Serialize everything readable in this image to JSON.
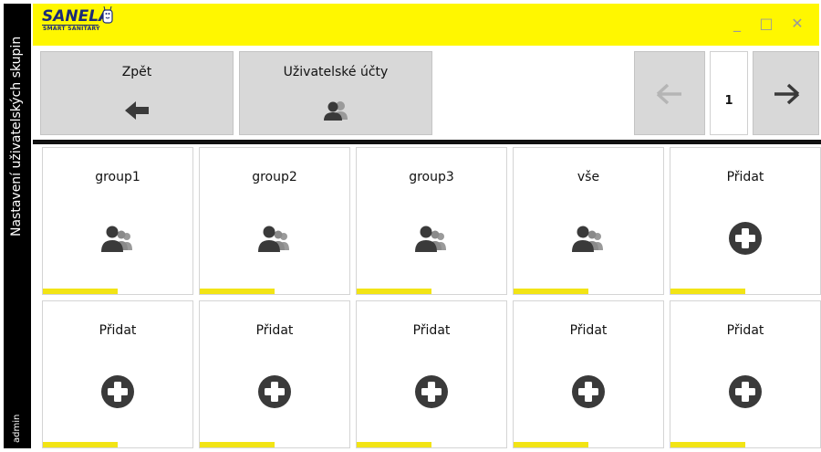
{
  "sidebar": {
    "title": "Nastavení uživatelských skupin",
    "user": "admin"
  },
  "titlebar": {
    "logo_text": "SANELA",
    "logo_subtitle": "SMART SANITARY",
    "brand_color": "#fff700",
    "window_controls": {
      "minimize": "_",
      "maximize": "□",
      "close": "✕"
    }
  },
  "toolbar": {
    "back_label": "Zpět",
    "back_icon": "arrow-left-icon",
    "accounts_label": "Uživatelské účty",
    "accounts_icon": "users-icon",
    "prev_icon": "arrow-left-icon",
    "page_number": "1",
    "next_icon": "arrow-right-icon"
  },
  "tiles": [
    {
      "label": "group1",
      "icon": "users-group-icon"
    },
    {
      "label": "group2",
      "icon": "users-group-icon"
    },
    {
      "label": "group3",
      "icon": "users-group-icon"
    },
    {
      "label": "vše",
      "icon": "users-group-icon"
    },
    {
      "label": "Přidat",
      "icon": "plus-circle-icon"
    },
    {
      "label": "Přidat",
      "icon": "plus-circle-icon"
    },
    {
      "label": "Přidat",
      "icon": "plus-circle-icon"
    },
    {
      "label": "Přidat",
      "icon": "plus-circle-icon"
    },
    {
      "label": "Přidat",
      "icon": "plus-circle-icon"
    },
    {
      "label": "Přidat",
      "icon": "plus-circle-icon"
    }
  ],
  "colors": {
    "accent": "#f2e415",
    "sidebar": "#000000",
    "button": "#d8d8d8",
    "icon_dark": "#3a3a3a"
  }
}
